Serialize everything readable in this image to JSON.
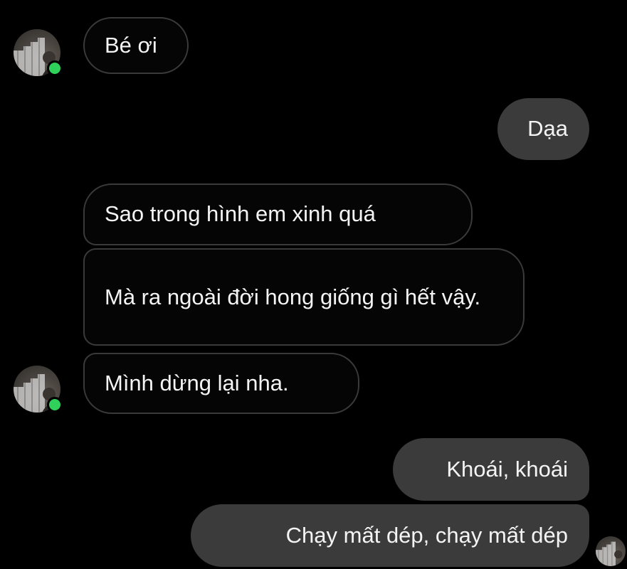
{
  "messages": [
    {
      "id": "m1",
      "direction": "incoming",
      "text": "Bé ơi"
    },
    {
      "id": "m2",
      "direction": "outgoing",
      "text": "Dạa"
    },
    {
      "id": "m3",
      "direction": "incoming",
      "text": "Sao trong hình em xinh quá"
    },
    {
      "id": "m4",
      "direction": "incoming",
      "text": "Mà ra ngoài đời hong giống gì hết vậy."
    },
    {
      "id": "m5",
      "direction": "incoming",
      "text": "Mình dừng lại nha."
    },
    {
      "id": "m6",
      "direction": "outgoing",
      "text": "Khoái, khoái"
    },
    {
      "id": "m7",
      "direction": "outgoing",
      "text": "Chạy mất dép, chạy mất dép"
    }
  ],
  "colors": {
    "background": "#000000",
    "incoming_border": "#3a3a3a",
    "outgoing_bubble": "#3b3b3b",
    "online_status": "#2fd15a",
    "text": "#f4f4f4"
  },
  "icons": {
    "contact_avatar": "contact-avatar-photo",
    "online_indicator": "online-dot",
    "read_receipt": "read-receipt-avatar"
  }
}
